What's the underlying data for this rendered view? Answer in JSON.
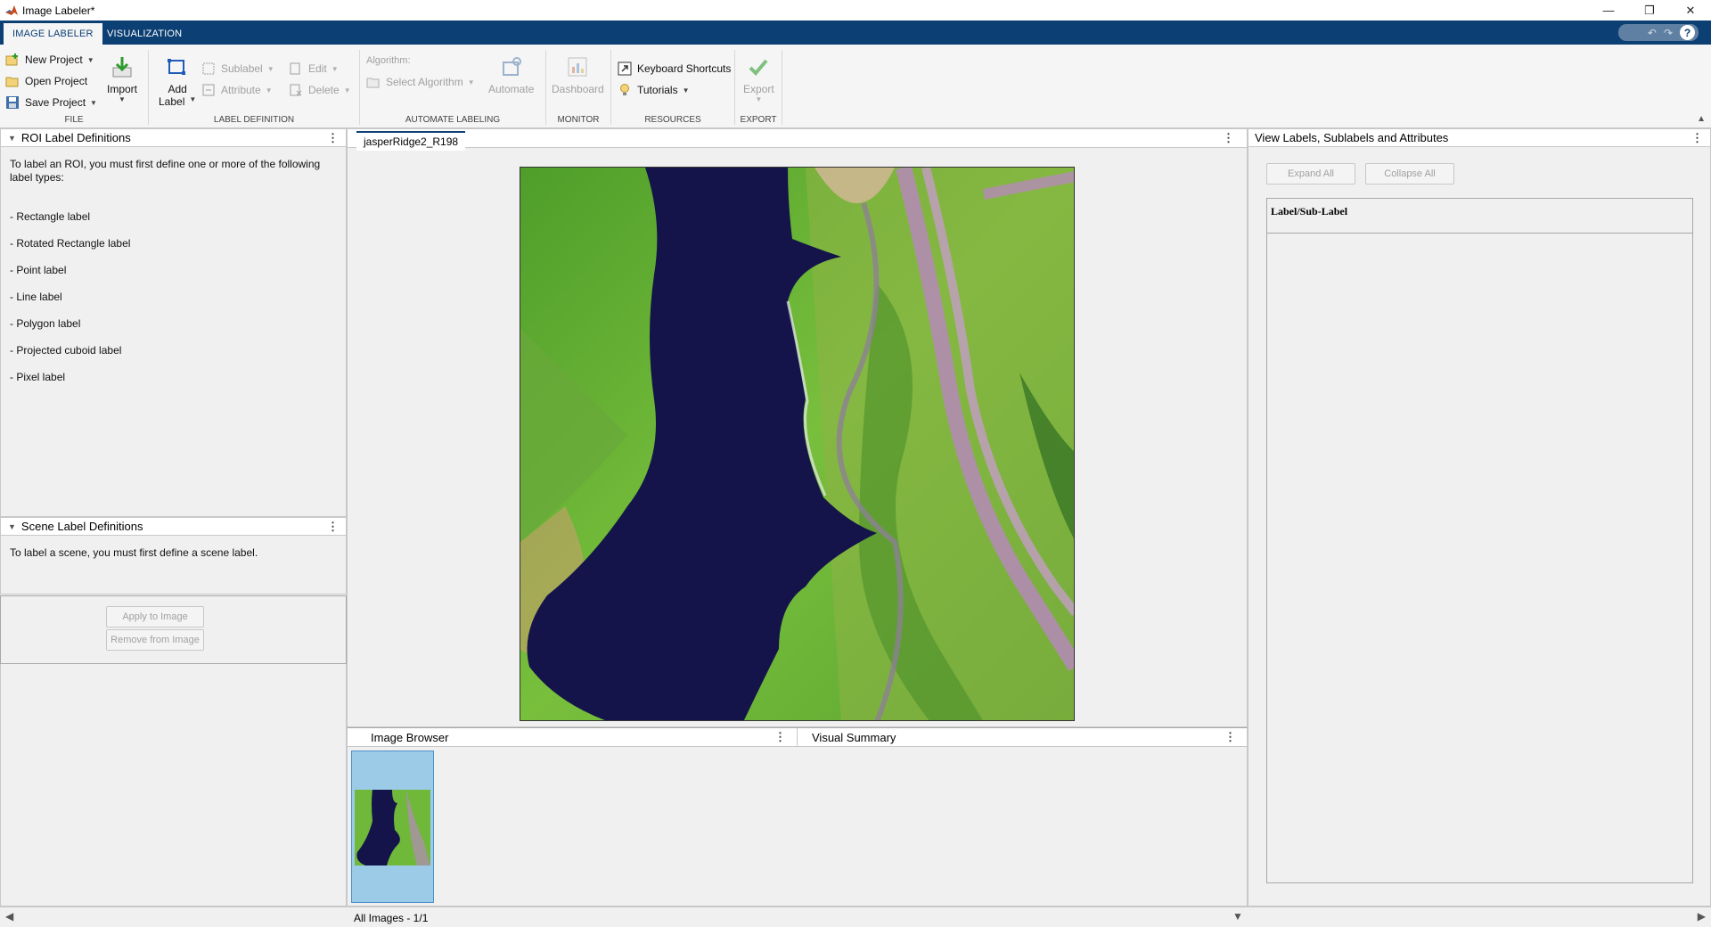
{
  "window": {
    "title": "Image Labeler*",
    "controls": [
      "minimize",
      "restore",
      "close"
    ]
  },
  "tabs": [
    {
      "label": "IMAGE LABELER",
      "active": true
    },
    {
      "label": "VISUALIZATION",
      "active": false
    }
  ],
  "ribbon": {
    "file": {
      "group_label": "FILE",
      "new_project": "New Project",
      "open_project": "Open Project",
      "save_project": "Save Project",
      "import": "Import"
    },
    "label_definition": {
      "group_label": "LABEL DEFINITION",
      "add_label_line1": "Add",
      "add_label_line2": "Label",
      "sublabel": "Sublabel",
      "attribute": "Attribute",
      "edit": "Edit",
      "delete": "Delete"
    },
    "automate_labeling": {
      "group_label": "AUTOMATE LABELING",
      "algorithm_label": "Algorithm:",
      "select_algorithm": "Select Algorithm",
      "automate": "Automate"
    },
    "monitor": {
      "group_label": "MONITOR",
      "dashboard": "Dashboard"
    },
    "resources": {
      "group_label": "RESOURCES",
      "keyboard_shortcuts": "Keyboard Shortcuts",
      "tutorials": "Tutorials"
    },
    "export": {
      "group_label": "EXPORT",
      "export": "Export"
    }
  },
  "roi_panel": {
    "title": "ROI Label Definitions",
    "intro": "To label an ROI, you must first define one or more of the following\nlabel types:",
    "types": [
      "- Rectangle label",
      "- Rotated Rectangle label",
      "- Point label",
      "- Line label",
      "- Polygon label",
      "- Projected cuboid label",
      "- Pixel label"
    ]
  },
  "scene_panel": {
    "title": "Scene Label Definitions",
    "text": "To label a scene, you must first define a scene label.",
    "apply_button": "Apply to Image",
    "remove_button": "Remove from Image"
  },
  "document": {
    "tab_label": "jasperRidge2_R198"
  },
  "image_browser": {
    "title": "Image Browser"
  },
  "visual_summary": {
    "title": "Visual Summary"
  },
  "right_panel": {
    "title": "View Labels, Sublabels and Attributes",
    "expand_all": "Expand All",
    "collapse_all": "Collapse All",
    "tree_header": "Label/Sub-Label"
  },
  "status": {
    "images_count": "All Images - 1/1"
  },
  "colors": {
    "ribbon_tab_bar": "#0c3f73",
    "water": "#14144a",
    "vegetation": "#6fb83a",
    "road": "#b58ab8",
    "thumbnail_selection": "#9ccbe8"
  }
}
